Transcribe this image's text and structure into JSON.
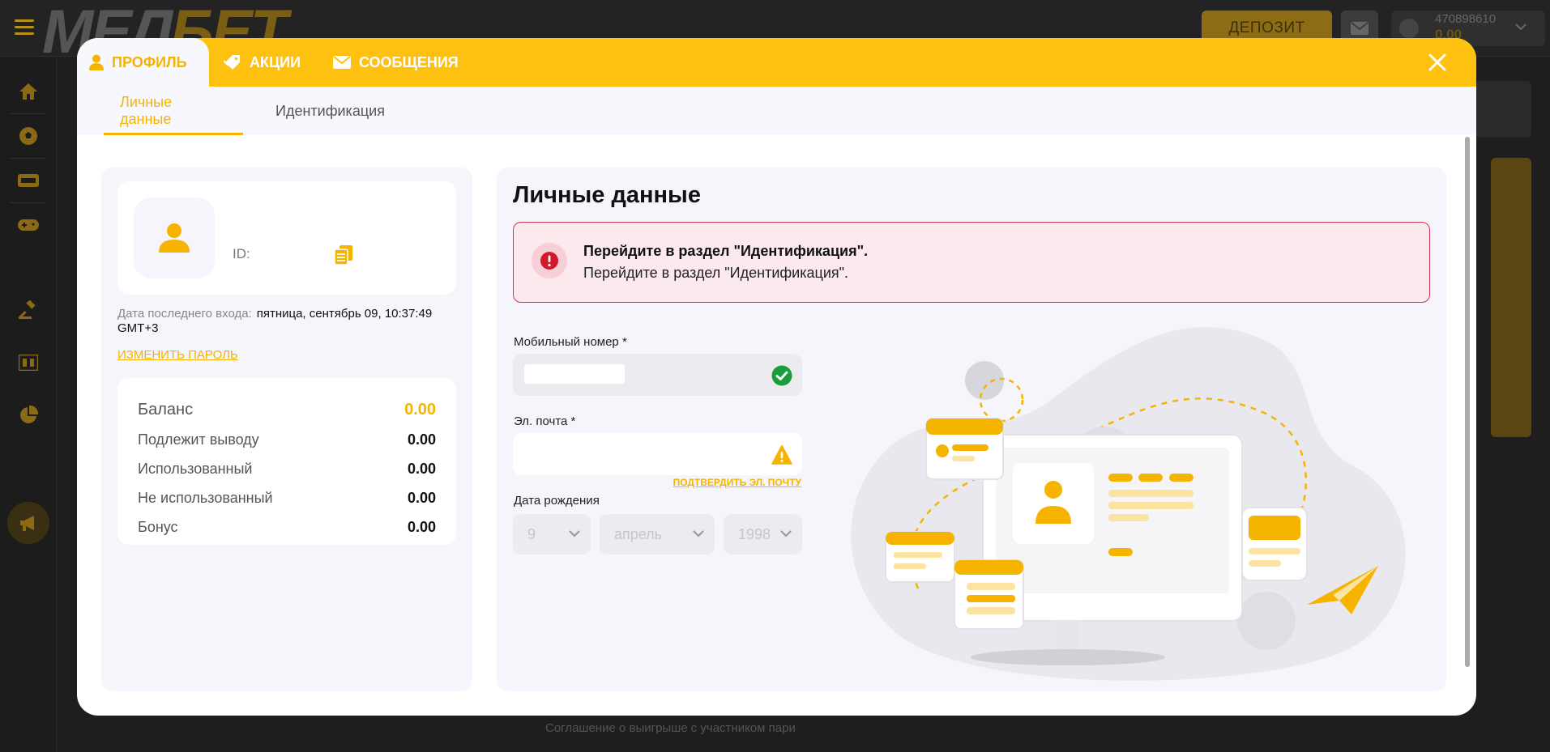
{
  "background": {
    "logo_left": "МЕЛ",
    "logo_right": "БЕТ",
    "deposit_label": "ДЕПОЗИТ",
    "account_id": "470898610",
    "account_balance": "0.00",
    "footer_link": "Соглашение о выигрыше с участником пари"
  },
  "modal": {
    "tabs": [
      {
        "label": "ПРОФИЛЬ",
        "icon": "user-icon"
      },
      {
        "label": "АКЦИИ",
        "icon": "tag-icon"
      },
      {
        "label": "СООБЩЕНИЯ",
        "icon": "envelope-icon"
      }
    ],
    "subtabs": [
      {
        "label": "Личные данные"
      },
      {
        "label": "Идентификация"
      }
    ]
  },
  "profile": {
    "id_label": "ID:",
    "last_login_label": "Дата последнего входа:",
    "last_login_value": "пятница, сентябрь 09, 10:37:49",
    "last_login_tz": "GMT+3",
    "change_password": "ИЗМЕНИТЬ ПАРОЛЬ",
    "balances": [
      {
        "label": "Баланс",
        "value": "0.00"
      },
      {
        "label": "Подлежит выводу",
        "value": "0.00"
      },
      {
        "label": "Использованный",
        "value": "0.00"
      },
      {
        "label": "Не использованный",
        "value": "0.00"
      },
      {
        "label": "Бонус",
        "value": "0.00"
      }
    ]
  },
  "personal": {
    "title": "Личные данные",
    "alert_title": "Перейдите в раздел \"Идентификация\".",
    "alert_text": "Перейдите в раздел \"Идентификация\".",
    "phone_label": "Мобильный номер *",
    "email_label": "Эл. почта *",
    "email_placeholder": "",
    "confirm_email": "ПОДТВЕРДИТЬ ЭЛ. ПОЧТУ",
    "birth_label": "Дата рождения",
    "birth_day": "9",
    "birth_month": "апрель",
    "birth_year": "1998"
  },
  "colors": {
    "accent": "#fec110",
    "accent_text": "#f6b400",
    "alert_border": "#c83a52",
    "success": "#1a9b3c"
  }
}
